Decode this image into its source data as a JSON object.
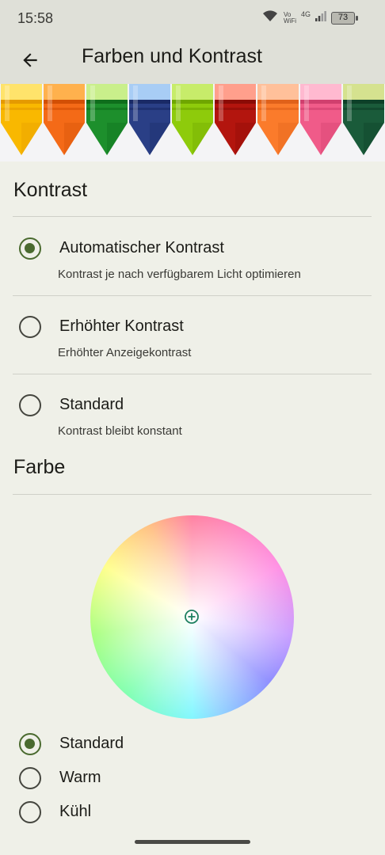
{
  "status_bar": {
    "time": "15:58",
    "vo_label": "Vo",
    "wifi_label": "WiFi",
    "network": "4G",
    "battery": "73"
  },
  "app_bar": {
    "title": "Farben und Kontrast",
    "back_icon": "arrow-back-icon"
  },
  "banner": {
    "crayon_colors": [
      {
        "body": "#f9b800",
        "light": "#ffe36b",
        "dark": "#e59a00"
      },
      {
        "body": "#f46a17",
        "light": "#ffb14d",
        "dark": "#d24f05"
      },
      {
        "body": "#1d8f2c",
        "light": "#c9ef8b",
        "dark": "#0f6e1c"
      },
      {
        "body": "#2a3f86",
        "light": "#a8cdf5",
        "dark": "#1a2a66"
      },
      {
        "body": "#8ecb0b",
        "light": "#c7ec6a",
        "dark": "#6fa600"
      },
      {
        "body": "#b3150e",
        "light": "#ff9f8c",
        "dark": "#8b0b06"
      },
      {
        "body": "#fb7b2b",
        "light": "#ffc09a",
        "dark": "#e0611a"
      },
      {
        "body": "#f05b89",
        "light": "#ffb9d0",
        "dark": "#d03f6e"
      },
      {
        "body": "#1a5b3a",
        "light": "#d5e28f",
        "dark": "#0d4028"
      }
    ]
  },
  "kontrast": {
    "title": "Kontrast",
    "options": [
      {
        "label": "Automatischer Kontrast",
        "sub": "Kontrast je nach verfügbarem Licht optimieren",
        "selected": true
      },
      {
        "label": "Erhöhter Kontrast",
        "sub": "Erhöhter Anzeigekontrast",
        "selected": false
      },
      {
        "label": "Standard",
        "sub": "Kontrast bleibt konstant",
        "selected": false
      }
    ]
  },
  "farbe": {
    "title": "Farbe",
    "wheel_center_icon": "plus-circle-icon",
    "options": [
      {
        "label": "Standard",
        "selected": true
      },
      {
        "label": "Warm",
        "selected": false
      },
      {
        "label": "Kühl",
        "selected": false
      }
    ]
  },
  "colors": {
    "accent": "#4a6a2f",
    "background": "#eff0e8",
    "bar": "#dfe0d8"
  }
}
